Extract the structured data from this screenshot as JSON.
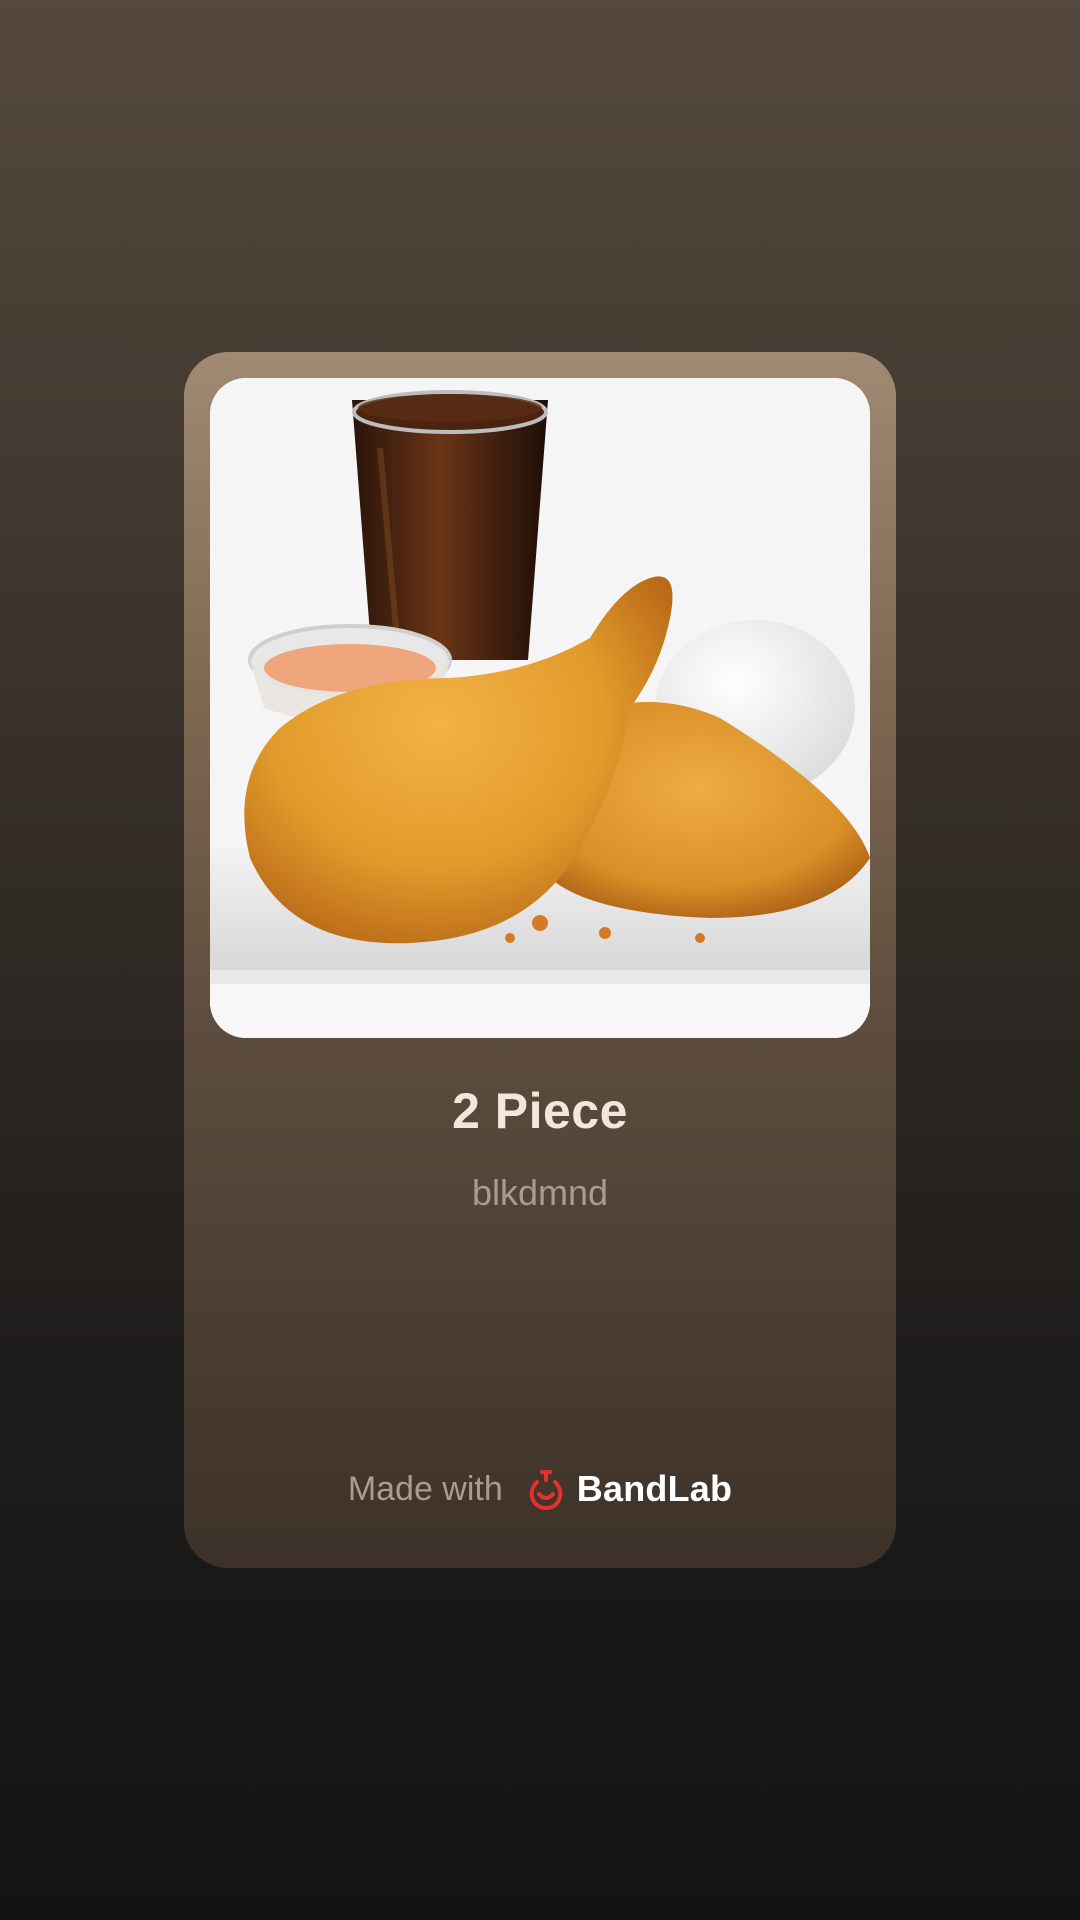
{
  "track": {
    "title": "2 Piece",
    "artist": "blkdmnd",
    "cover_art_subject": "fried chicken meal with soda, rice and dip"
  },
  "footer": {
    "made_with_label": "Made with",
    "brand_name": "BandLab",
    "brand_icon": "bandlab-logo-icon"
  },
  "colors": {
    "brand_red": "#e5312b",
    "title_text": "#f3e6da",
    "artist_text": "#a89b90"
  }
}
